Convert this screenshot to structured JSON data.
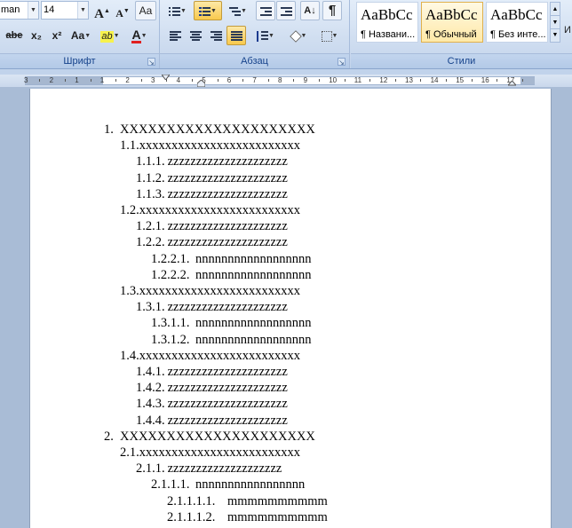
{
  "ribbon": {
    "font_group": {
      "label": "Шрифт",
      "font_name": "man",
      "font_size": "14",
      "grow_label": "A",
      "shrink_label": "A",
      "clear_label": "Aa",
      "strike_label": "abe",
      "sub_label": "x₂",
      "sup_label": "x²",
      "case_label": "Aa",
      "highlight_label": "ab",
      "color_label": "A"
    },
    "paragraph_group": {
      "label": "Абзац",
      "sort_label": "A↓",
      "marks_label": "¶"
    },
    "styles_group": {
      "label": "Стили",
      "styles": [
        {
          "sample": "AaBbCc",
          "name": "¶ Названи..."
        },
        {
          "sample": "AaBbCc",
          "name": "¶ Обычный"
        },
        {
          "sample": "AaBbCc",
          "name": "¶ Без инте..."
        }
      ],
      "side_label": "И"
    }
  },
  "ruler": {
    "numbers": [
      "3",
      "2",
      "1",
      "1",
      "2",
      "3",
      "4",
      "5",
      "6",
      "7",
      "8",
      "9",
      "10",
      "11",
      "12",
      "13",
      "14",
      "15",
      "16",
      "17"
    ]
  },
  "document": {
    "lines": [
      {
        "num": "1.",
        "text": "XXXXXXXXXXXXXXXXXXXXX"
      },
      {
        "num": "1.1.",
        "text": "xxxxxxxxxxxxxxxxxxxxxxxxx"
      },
      {
        "num": "1.1.1.",
        "text": "zzzzzzzzzzzzzzzzzzzzz"
      },
      {
        "num": "1.1.2.",
        "text": "zzzzzzzzzzzzzzzzzzzzz"
      },
      {
        "num": "1.1.3.",
        "text": "zzzzzzzzzzzzzzzzzzzzz"
      },
      {
        "num": "1.2.",
        "text": "xxxxxxxxxxxxxxxxxxxxxxxxx"
      },
      {
        "num": "1.2.1.",
        "text": "zzzzzzzzzzzzzzzzzzzzz"
      },
      {
        "num": "1.2.2.",
        "text": "zzzzzzzzzzzzzzzzzzzzz"
      },
      {
        "num": "1.2.2.1.",
        "text": "nnnnnnnnnnnnnnnnnn"
      },
      {
        "num": "1.2.2.2.",
        "text": "nnnnnnnnnnnnnnnnnn"
      },
      {
        "num": "1.3.",
        "text": "xxxxxxxxxxxxxxxxxxxxxxxxx"
      },
      {
        "num": "1.3.1.",
        "text": "zzzzzzzzzzzzzzzzzzzzz"
      },
      {
        "num": "1.3.1.1.",
        "text": "nnnnnnnnnnnnnnnnnn"
      },
      {
        "num": "1.3.1.2.",
        "text": "nnnnnnnnnnnnnnnnnn"
      },
      {
        "num": "1.4.",
        "text": "xxxxxxxxxxxxxxxxxxxxxxxxx"
      },
      {
        "num": "1.4.1.",
        "text": "zzzzzzzzzzzzzzzzzzzzz"
      },
      {
        "num": "1.4.2.",
        "text": "zzzzzzzzzzzzzzzzzzzzz"
      },
      {
        "num": "1.4.3.",
        "text": "zzzzzzzzzzzzzzzzzzzzz"
      },
      {
        "num": "1.4.4.",
        "text": "zzzzzzzzzzzzzzzzzzzzz"
      },
      {
        "num": "2.",
        "text": "XXXXXXXXXXXXXXXXXXXXX"
      },
      {
        "num": "2.1.",
        "text": "xxxxxxxxxxxxxxxxxxxxxxxxx"
      },
      {
        "num": "2.1.1.",
        "text": "zzzzzzzzzzzzzzzzzzzz"
      },
      {
        "num": "2.1.1.1.",
        "text": "nnnnnnnnnnnnnnnnn"
      },
      {
        "num": "2.1.1.1.1.",
        "text": "mmmmmmmmmm"
      },
      {
        "num": "2.1.1.1.2.",
        "text": "mmmmmmmmmm"
      }
    ]
  }
}
